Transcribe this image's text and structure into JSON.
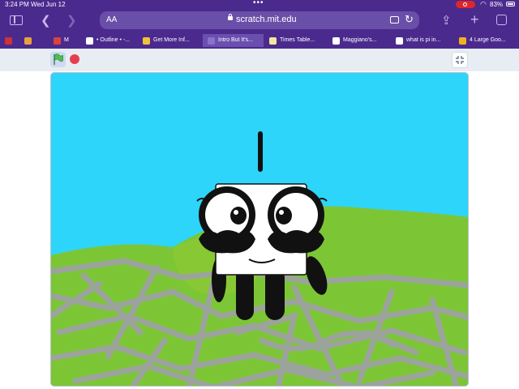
{
  "status_bar": {
    "time": "3:24 PM",
    "date": "Wed Jun 12",
    "battery": "83%"
  },
  "browser": {
    "text_size_label": "AA",
    "url": "scratch.mit.edu",
    "tabs": [
      {
        "label": "",
        "favicon_color": "#cc3333"
      },
      {
        "label": "",
        "favicon_color": "#e8a23c"
      },
      {
        "label": "M",
        "favicon_color": "#d9433c"
      },
      {
        "label": "• Outline • -...",
        "favicon_color": "#ffffff"
      },
      {
        "label": "Get More Inf...",
        "favicon_color": "#f0c23a"
      },
      {
        "label": "Intro But It's...",
        "favicon_color": "#8a72c8"
      },
      {
        "label": "Times Table...",
        "favicon_color": "#f2e6a0"
      },
      {
        "label": "Maggiano's...",
        "favicon_color": "#ffffff"
      },
      {
        "label": "what is pi in...",
        "favicon_color": "#ffffff"
      },
      {
        "label": "4 Large Goo...",
        "favicon_color": "#f2b020"
      }
    ],
    "active_tab_index": 5
  },
  "player": {
    "icons": [
      "green-flag-icon",
      "stop-icon",
      "fullscreen-icon"
    ],
    "colors": {
      "flag": "#4cbf56",
      "stop": "#e5404d",
      "sky": "#2ed5fa",
      "hill": "#7cc636",
      "scribble": "#9b9b9b"
    }
  }
}
